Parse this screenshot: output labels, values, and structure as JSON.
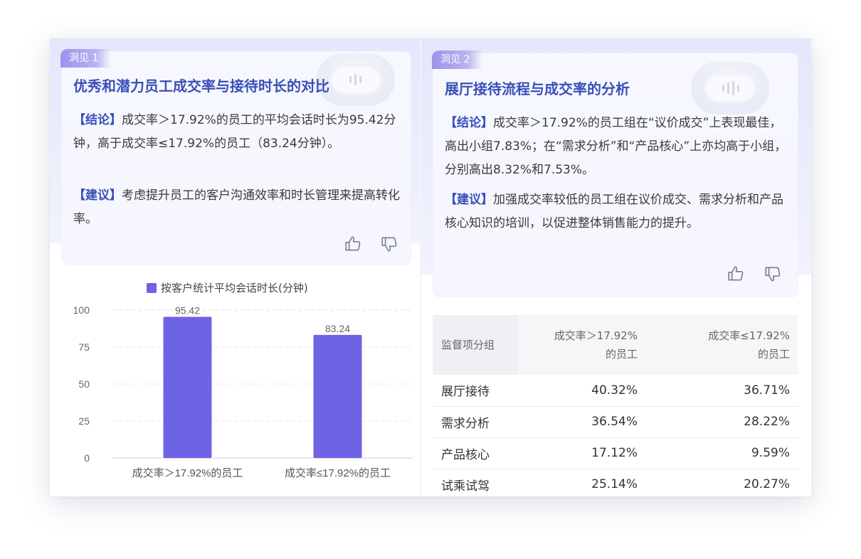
{
  "insight1": {
    "tag": "洞见 1",
    "title": "优秀和潜力员工成交率与接待时长的对比",
    "conclusion_label": "【结论】",
    "conclusion": "成交率＞17.92%的员工的平均会话时长为95.42分钟，高于成交率≤17.92%的员工（83.24分钟）。",
    "suggestion_label": "【建议】",
    "suggestion": "考虑提升员工的客户沟通效率和时长管理来提高转化率。"
  },
  "insight2": {
    "tag": "洞见 2",
    "title": "展厅接待流程与成交率的分析",
    "conclusion_label": "【结论】",
    "conclusion": "成交率＞17.92%的员工组在“议价成交”上表现最佳，高出小组7.83%；在“需求分析”和“产品核心”上亦均高于小组，分别高出8.32%和7.53%。",
    "suggestion_label": "【建议】",
    "suggestion": "加强成交率较低的员工组在议价成交、需求分析和产品核心知识的培训，以促进整体销售能力的提升。"
  },
  "icons": {
    "like": "thumbs-up-icon",
    "dislike": "thumbs-down-icon",
    "mascot": "robot-mascot-icon"
  },
  "colors": {
    "accent": "#3a4fb8",
    "bar": "#6f63e5",
    "tag": "#9d92ec"
  },
  "chart_data": {
    "type": "bar",
    "categories": [
      "成交率＞17.92%的员工",
      "成交率≤17.92%的员工"
    ],
    "series": [
      {
        "name": "按客户统计平均会话时长(分钟)",
        "values": [
          95.42,
          83.24
        ]
      }
    ],
    "data_labels": [
      "95.42",
      "83.24"
    ],
    "yticks": [
      "100",
      "75",
      "50",
      "25",
      "0"
    ],
    "ylim": [
      0,
      100
    ],
    "grid": true,
    "legend": "top-center"
  },
  "table": {
    "headers": [
      "监督项分组",
      "成交率＞17.92%\n的员工",
      "成交率≤17.92%\n的员工"
    ],
    "rows": [
      [
        "展厅接待",
        "40.32%",
        "36.71%"
      ],
      [
        "需求分析",
        "36.54%",
        "28.22%"
      ],
      [
        "产品核心",
        "17.12%",
        "9.59%"
      ],
      [
        "试乘试驾",
        "25.14%",
        "20.27%"
      ]
    ]
  }
}
